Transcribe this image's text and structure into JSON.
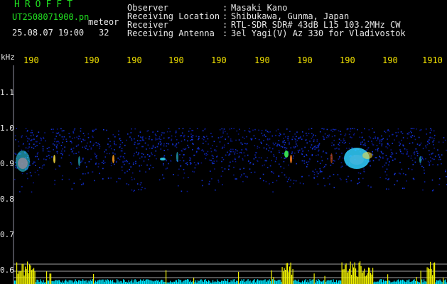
{
  "header": {
    "title": "HROFFT",
    "filename": "UT2508071900.pn",
    "mode": "meteor",
    "datetime": "25.08.07 19:00",
    "count": "32"
  },
  "metadata": [
    {
      "label": "Observer",
      "value": "Masaki Kano"
    },
    {
      "label": "Receiving Location",
      "value": "Shibukawa, Gunma, Japan"
    },
    {
      "label": "Receiver",
      "value": "RTL-SDR SDR# 43dB L15 103.2MHz CW"
    },
    {
      "label": "Receiving Antenna",
      "value": "3el Yagi(V) Az 330 for Vladivostok"
    }
  ],
  "spectrogram": {
    "unit": "kHz",
    "y_labels": [
      "1.1",
      "1.0",
      "0.9",
      "0.8",
      "0.7",
      "0.6"
    ],
    "time_ticks": [
      "190",
      "190",
      "190",
      "190",
      "190",
      "190",
      "190",
      "190",
      "190",
      "1910"
    ],
    "colors": {
      "text_green": "#20e020",
      "tick_yellow": "#f0e000",
      "trace_cyan": "#00e8ff",
      "bar_yellow": "#f0f000"
    }
  }
}
